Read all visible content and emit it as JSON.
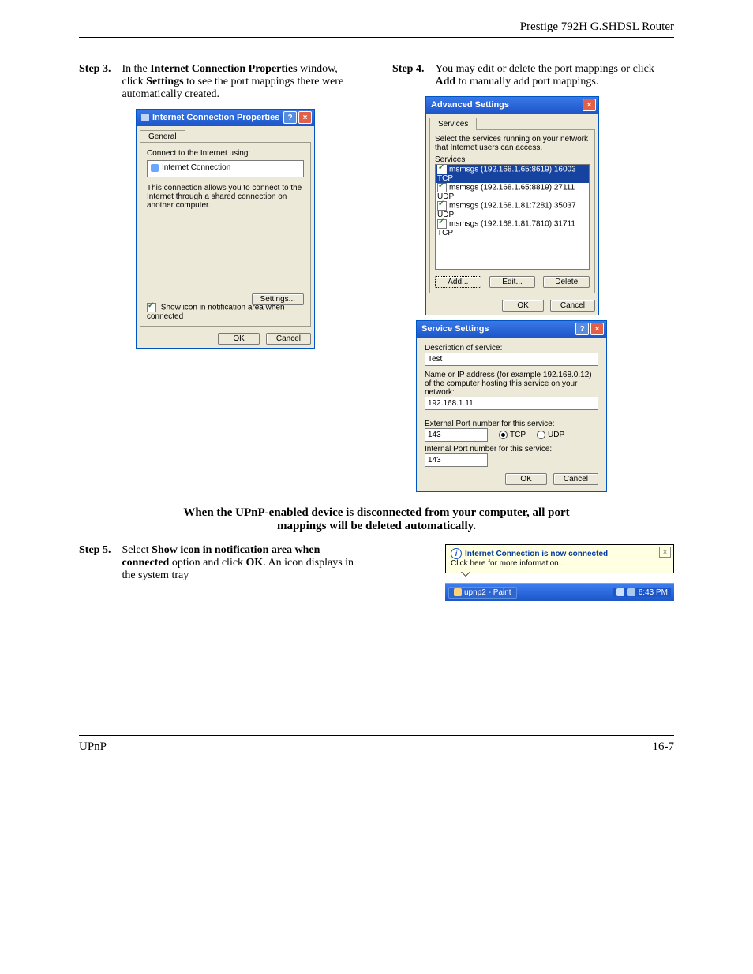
{
  "header": {
    "product": "Prestige 792H G.SHDSL Router"
  },
  "step3": {
    "label": "Step 3.",
    "pre": "In the ",
    "b1": "Internet Connection Properties",
    "mid": " window, click ",
    "b2": "Settings",
    "tail": " to see the port mappings there were automatically created."
  },
  "step4": {
    "label": "Step 4.",
    "pre": "You may edit or delete the port mappings or click ",
    "b1": "Add",
    "tail": " to manually add port mappings."
  },
  "step5": {
    "label": "Step 5.",
    "pre": "Select ",
    "b1": "Show icon in notification area when connected",
    "mid": " option and click ",
    "b2": "OK",
    "tail": ". An icon displays in the system tray"
  },
  "note": {
    "line1": "When the UPnP-enabled device is disconnected from your computer, all port",
    "line2": "mappings will be deleted automatically."
  },
  "icp": {
    "title": "Internet Connection Properties",
    "tab": "General",
    "connect_label": "Connect to the Internet using:",
    "conn_name": "Internet Connection",
    "desc": "This connection allows you to connect to the Internet through a shared connection on another computer.",
    "settings_btn": "Settings...",
    "show_icon": "Show icon in notification area when connected",
    "ok": "OK",
    "cancel": "Cancel"
  },
  "adv": {
    "title": "Advanced Settings",
    "tab": "Services",
    "intro": "Select the services running on your network that Internet users can access.",
    "list_label": "Services",
    "items": [
      "msmsgs (192.168.1.65:8619) 16003 TCP",
      "msmsgs (192.168.1.65:8819) 27111 UDP",
      "msmsgs (192.168.1.81:7281) 35037 UDP",
      "msmsgs (192.168.1.81:7810) 31711 TCP"
    ],
    "add": "Add...",
    "edit": "Edit...",
    "delete": "Delete",
    "ok": "OK",
    "cancel": "Cancel"
  },
  "svc": {
    "title": "Service Settings",
    "desc_label": "Description of service:",
    "desc_value": "Test",
    "host_label": "Name or IP address (for example 192.168.0.12) of the computer hosting this service on your network:",
    "host_value": "192.168.1.11",
    "ext_label": "External Port number for this service:",
    "ext_value": "143",
    "tcp": "TCP",
    "udp": "UDP",
    "int_label": "Internal Port number for this service:",
    "int_value": "143",
    "ok": "OK",
    "cancel": "Cancel"
  },
  "balloon": {
    "title": "Internet Connection is now connected",
    "text": "Click here for more information..."
  },
  "taskbar": {
    "item": "upnp2 - Paint",
    "clock": "6:43 PM"
  },
  "footer": {
    "left": "UPnP",
    "right": "16-7"
  }
}
